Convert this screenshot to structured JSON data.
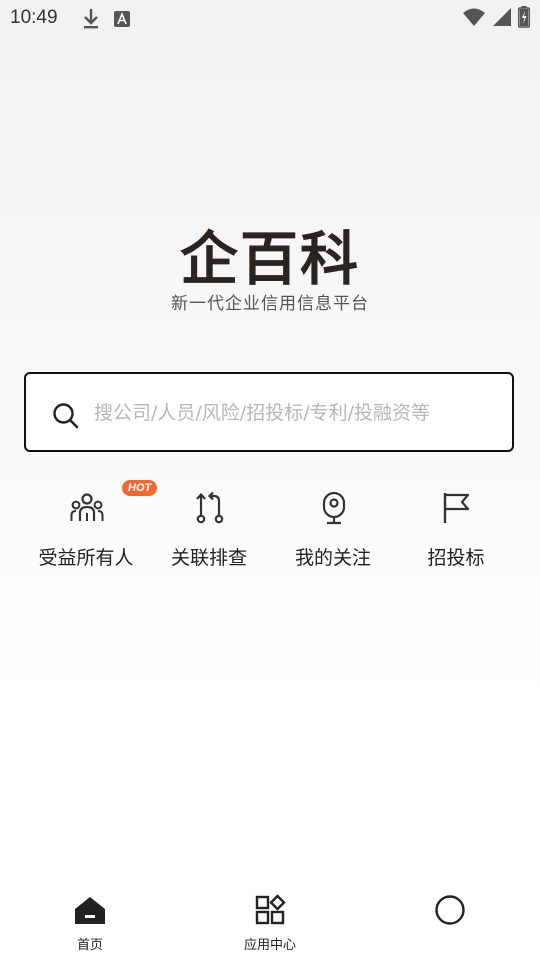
{
  "status_bar": {
    "time": "10:49",
    "left_icons": [
      "download-icon",
      "text-a-icon"
    ],
    "right_icons": [
      "wifi-icon",
      "cell-signal-icon",
      "battery-charging-icon"
    ]
  },
  "brand": {
    "logo": "企百科",
    "slogan": "新一代企业信用信息平台"
  },
  "search": {
    "placeholder": "搜公司/人员/风险/招投标/专利/投融资等",
    "value": ""
  },
  "quick_actions": [
    {
      "label": "受益所有人",
      "icon": "people-group-icon",
      "badge": "HOT"
    },
    {
      "label": "关联排查",
      "icon": "link-trace-icon"
    },
    {
      "label": "我的关注",
      "icon": "camera-watch-icon"
    },
    {
      "label": "招投标",
      "icon": "flag-icon"
    }
  ],
  "bottom_nav": {
    "items": [
      {
        "label": "首页",
        "icon": "home-icon",
        "active": true
      },
      {
        "label": "应用中心",
        "icon": "apps-grid-icon",
        "active": false
      },
      {
        "label": "",
        "icon": "circle-icon",
        "active": false
      }
    ]
  },
  "colors": {
    "badge": "#f26a2f",
    "logo": "#2a2421",
    "placeholder": "#b7b7b7"
  }
}
